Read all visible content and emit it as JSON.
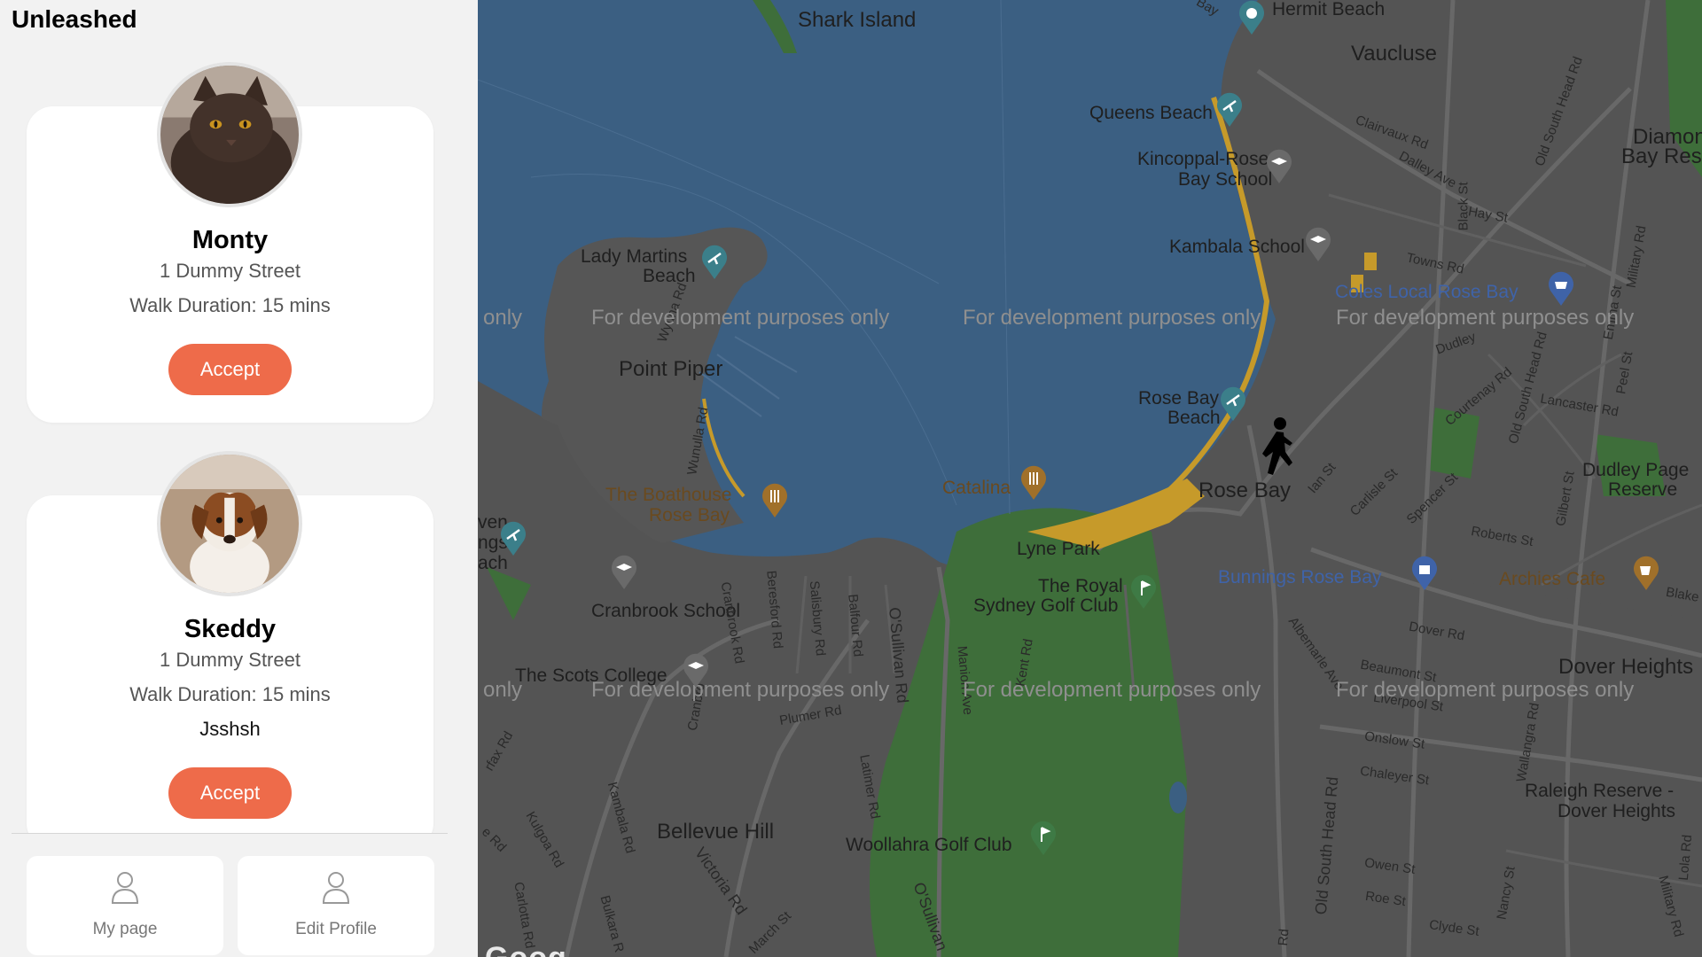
{
  "app": {
    "title": "Unleashed"
  },
  "requests": [
    {
      "name": "Monty",
      "address": "1 Dummy Street",
      "duration": "Walk Duration: 15 mins",
      "note": "",
      "accept_label": "Accept",
      "photo_icon": "cat-photo"
    },
    {
      "name": "Skeddy",
      "address": "1 Dummy Street",
      "duration": "Walk Duration: 15 mins",
      "note": "Jsshsh",
      "accept_label": "Accept",
      "photo_icon": "dog-photo"
    }
  ],
  "bottom_tabs": [
    {
      "label": "My page",
      "icon": "person-icon"
    },
    {
      "label": "Edit Profile",
      "icon": "person-icon"
    }
  ],
  "map": {
    "watermark": "For development purposes only",
    "watermark_fragment": "only",
    "places": {
      "shark_island": "Shark Island",
      "hermit_beach": "Hermit Beach",
      "vaucluse": "Vaucluse",
      "queens_beach": "Queens Beach",
      "kincoppal_1": "Kincoppal-Rose",
      "kincoppal_2": "Bay School",
      "kambala": "Kambala School",
      "coles": "Coles Local Rose Bay",
      "diamond_1": "Diamon",
      "diamond_2": "Bay Rese",
      "lady_martins_1": "Lady Martins",
      "lady_martins_2": "Beach",
      "point_piper": "Point Piper",
      "rose_bay_beach_1": "Rose Bay",
      "rose_bay_beach_2": "Beach",
      "rose_bay": "Rose Bay",
      "catalina": "Catalina",
      "boathouse_1": "The Boathouse",
      "boathouse_2": "Rose Bay",
      "dudley_1": "Dudley Page",
      "dudley_2": "Reserve",
      "lyne_park": "Lyne Park",
      "royal_sydney_1": "The Royal",
      "royal_sydney_2": "Sydney Golf Club",
      "bunnings": "Bunnings Rose Bay",
      "archies": "Archies Cafe",
      "cranbrook": "Cranbrook School",
      "scots": "The Scots College",
      "dover_heights": "Dover Heights",
      "raleigh_1": "Raleigh Reserve -",
      "raleigh_2": "Dover Heights",
      "bellevue_hill": "Bellevue Hill",
      "woollahra_golf": "Woollahra Golf Club",
      "even_1": "ven",
      "even_2": "ngs",
      "even_3": "ach"
    },
    "streets": {
      "clairvaux": "Clairvaux Rd",
      "dalley": "Dalley Ave",
      "black": "Black St",
      "hay": "Hay St",
      "towns": "Towns Rd",
      "old_south_head_top": "Old South Head Rd",
      "military_top": "Military Rd",
      "wyuna": "Wyuna Rd",
      "wunulla": "Wunulla Rd",
      "dudley_st": "Dudley",
      "courtenay": "Courtenay Rd",
      "old_south_head_mid": "Old South Head Rd",
      "lancaster": "Lancaster Rd",
      "peel": "Peel St",
      "emma": "Emma St",
      "carlisle": "Carlisle St",
      "spencer": "Spencer St",
      "roberts": "Roberts St",
      "gilbert": "Gilbert St",
      "ian": "Ian St",
      "cranbrook_rd": "Cranbrook Rd",
      "beresford": "Beresford Rd",
      "salisbury": "Salisbury Rd",
      "balfour": "Balfour Rd",
      "osullivan": "O'Sullivan Rd",
      "manion": "Manion Ave",
      "kent": "Kent Rd",
      "albemarle": "Albemarle Ave",
      "dover_rd": "Dover Rd",
      "beaumont": "Beaumont St",
      "liverpool": "Liverpool St",
      "onslow": "Onslow St",
      "chaleyer": "Chaleyer St",
      "plumer": "Plumer Rd",
      "latimer": "Latimer Rd",
      "old_south_head_low": "Old South Head Rd",
      "wallangra": "Wallangra Rd",
      "owen": "Owen St",
      "roe": "Roe St",
      "clyde": "Clyde St",
      "nancy": "Nancy St",
      "lola": "Lola Rd",
      "military_low": "Military Rd",
      "victoria": "Victoria Rd",
      "osullivan_low": "O'Sullivan",
      "kambala_rd": "Kambala Rd",
      "kulgoa": "Kulgoa Rd",
      "fairfax": "rfax Rd",
      "ed": "e Rd",
      "carlotta": "Carlotta Rd",
      "bulkara": "Bulkara R",
      "march": "March St",
      "blake": "Blake S",
      "bay": "Bay",
      "cranbrook_2": "Cranbro",
      "dr": "Rd"
    },
    "attribution": "Goog"
  },
  "colors": {
    "accent": "#ee6b4a",
    "water": "#3b5f82",
    "land": "#545454",
    "park": "#3e6e3a",
    "sand": "#c69a2a"
  }
}
